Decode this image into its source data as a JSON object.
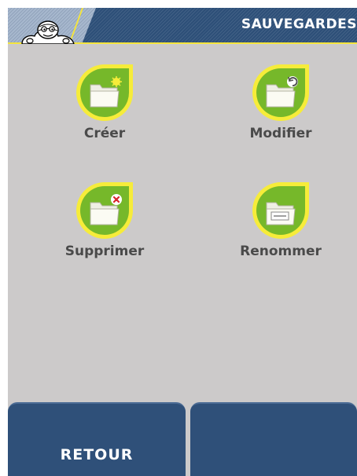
{
  "header": {
    "title": "SAUVEGARDES",
    "logo": "michelin-man-logo"
  },
  "actions": [
    {
      "label": "Créer",
      "icon": "folder-create-icon"
    },
    {
      "label": "Modifier",
      "icon": "folder-modify-icon"
    },
    {
      "label": "Supprimer",
      "icon": "folder-delete-icon"
    },
    {
      "label": "Renommer",
      "icon": "folder-rename-icon"
    }
  ],
  "footer": {
    "back_label": "RETOUR",
    "right_label": ""
  },
  "colors": {
    "header_bg": "#2d4f78",
    "accent_yellow": "#f5e53c",
    "icon_green": "#76b82a",
    "content_bg": "#cccaca",
    "button_bg": "#2f5079"
  }
}
